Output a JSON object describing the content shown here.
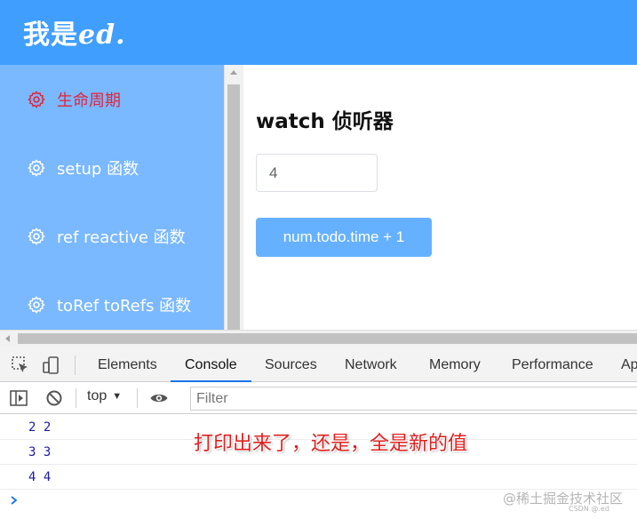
{
  "header": {
    "brand_main": "我是",
    "brand_accent": "ed."
  },
  "sidebar": {
    "items": [
      {
        "label": "生命周期",
        "icon": "gear-icon",
        "active": true
      },
      {
        "label": "setup 函数",
        "icon": "gear-icon",
        "active": false
      },
      {
        "label": "ref reactive 函数",
        "icon": "gear-icon",
        "active": false
      },
      {
        "label": "toRef toRefs 函数",
        "icon": "gear-icon",
        "active": false
      }
    ]
  },
  "main": {
    "title": "watch 侦听器",
    "input_value": "4",
    "button_label": "num.todo.time + 1"
  },
  "devtools": {
    "tabs": [
      "Elements",
      "Console",
      "Sources",
      "Network",
      "Memory",
      "Performance",
      "Ap"
    ],
    "active_tab": "Console",
    "context": "top",
    "filter_placeholder": "Filter",
    "logs": [
      "2  2",
      "3  3",
      "4  4"
    ]
  },
  "annotation": "打印出来了，还是，全是新的值",
  "watermark": "@稀土掘金技术社区",
  "watermark_small": "CSDN @.ed",
  "colors": {
    "header_bg": "#409eff",
    "sidebar_bg": "#7ab8ff",
    "active_menu": "#e0263a",
    "button_bg": "#66b1ff",
    "annotation": "#e02020",
    "tab_underline": "#1a73e8"
  }
}
